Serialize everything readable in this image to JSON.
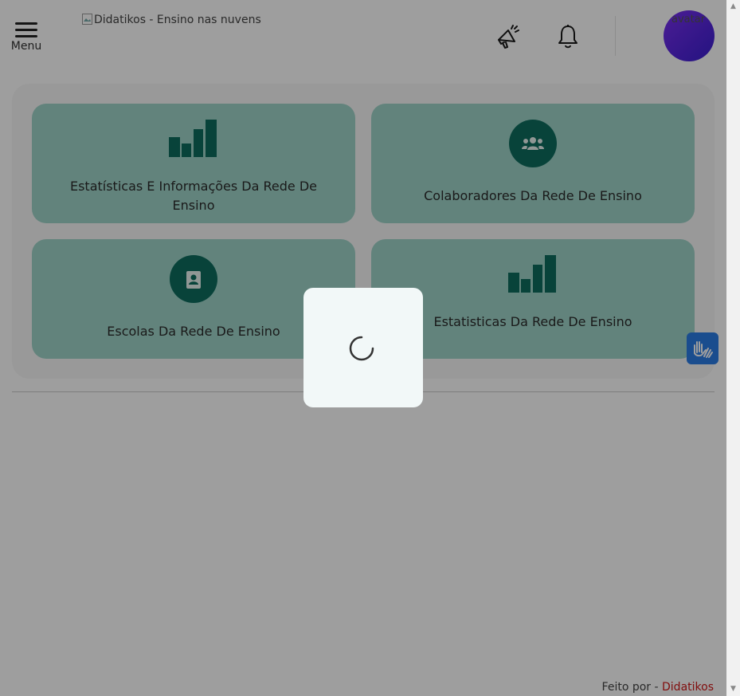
{
  "header": {
    "menu_label": "Menu",
    "logo_alt": "Didatikos - Ensino nas nuvens",
    "announce_icon": "megaphone-icon",
    "bell_icon": "bell-icon",
    "avatar_alt": "avatar"
  },
  "cards": [
    {
      "label": "Estatísticas E Informações Da Rede De Ensino",
      "icon": "bar-chart-icon"
    },
    {
      "label": "Colaboradores Da Rede De Ensino",
      "icon": "users-icon"
    },
    {
      "label": "Escolas Da Rede De Ensino",
      "icon": "school-badge-icon"
    },
    {
      "label": "Estatisticas Da Rede De Ensino",
      "icon": "bar-chart-icon"
    }
  ],
  "footer": {
    "made_by": "Feito por - ",
    "brand": "Didatikos"
  },
  "loading": {
    "icon": "spinner-icon"
  },
  "colors": {
    "card_bg": "#9fd4c9",
    "icon_teal": "#0d6c5e",
    "avatar_gradient_start": "#7a2ff0",
    "brand_red": "#d01818",
    "accessibility_blue": "#2b7ce6"
  }
}
